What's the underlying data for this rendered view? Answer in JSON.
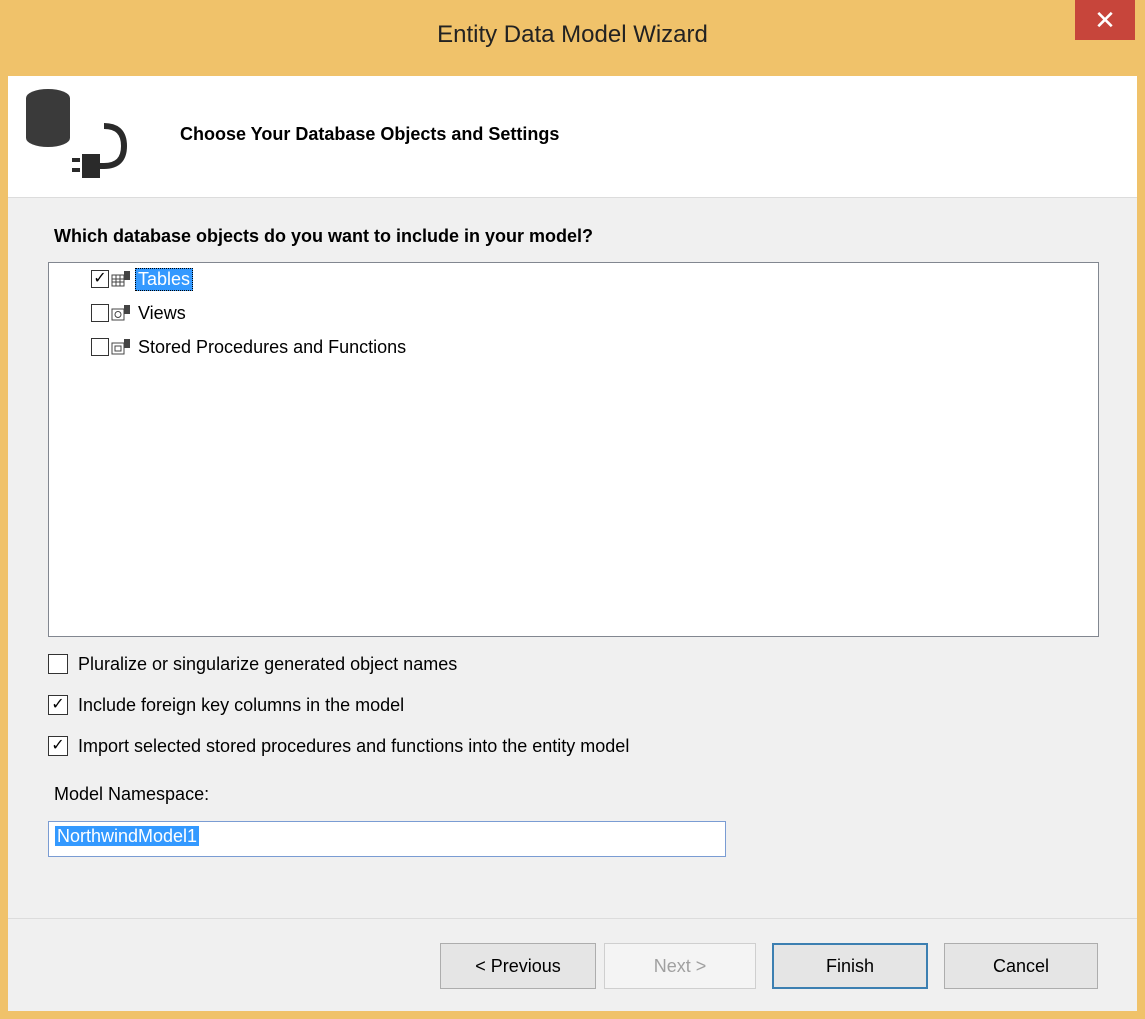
{
  "window": {
    "title": "Entity Data Model Wizard",
    "close_glyph": "✕"
  },
  "header": {
    "title": "Choose Your Database Objects and Settings",
    "icon": "database-connect-icon"
  },
  "objects": {
    "question": "Which database objects do you want to include in your model?",
    "items": [
      {
        "label": "Tables",
        "checked": "✓",
        "selected": true,
        "icon": "table-icon"
      },
      {
        "label": "Views",
        "checked": "",
        "selected": false,
        "icon": "view-icon"
      },
      {
        "label": "Stored Procedures and Functions",
        "checked": "",
        "selected": false,
        "icon": "stored-procedure-icon"
      }
    ]
  },
  "options": [
    {
      "label": "Pluralize or singularize generated object names",
      "checked": ""
    },
    {
      "label": "Include foreign key columns in the model",
      "checked": "✓"
    },
    {
      "label": "Import selected stored procedures and functions into the entity model",
      "checked": "✓"
    }
  ],
  "namespace": {
    "label": "Model Namespace:",
    "value": "NorthwindModel1"
  },
  "buttons": {
    "previous": "< Previous",
    "next": "Next >",
    "finish": "Finish",
    "cancel": "Cancel"
  },
  "colors": {
    "selection": "#3399ff",
    "title_bar": "#f0c26a",
    "close": "#c7453b"
  }
}
